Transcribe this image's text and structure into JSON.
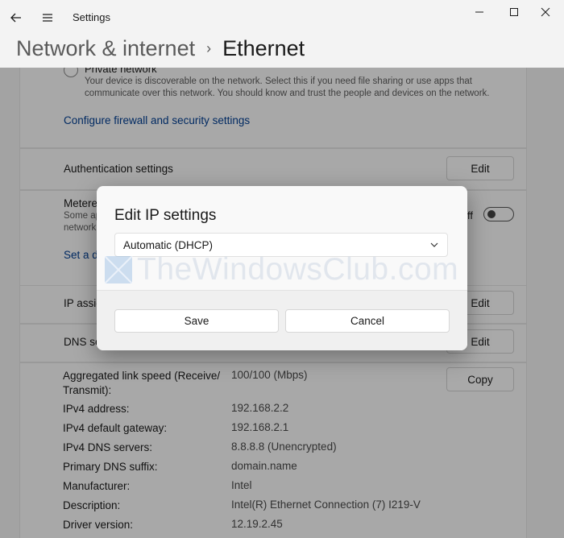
{
  "window": {
    "app_title": "Settings",
    "back_icon": "arrow-left-icon",
    "menu_icon": "hamburger-icon"
  },
  "breadcrumb": {
    "parent": "Network & internet",
    "separator": "›",
    "current": "Ethernet"
  },
  "network_profile": {
    "private_label": "Private network",
    "private_desc": "Your device is discoverable on the network. Select this if you need file sharing or use apps that communicate over this network. You should know and trust the people and devices on the network.",
    "firewall_link": "Configure firewall and security settings"
  },
  "authentication": {
    "label": "Authentication settings",
    "edit_label": "Edit"
  },
  "metered": {
    "label": "Metere",
    "desc_line1": "Some ap",
    "desc_line2": "network",
    "toggle_state": "ff",
    "data_limit_link": "Set a d"
  },
  "ip_assignment": {
    "label": "IP assig",
    "edit_label": "Edit"
  },
  "dns_assignment": {
    "label": "DNS se",
    "edit_label": "Edit"
  },
  "properties": {
    "copy_label": "Copy",
    "rows": [
      {
        "label": "Aggregated link speed (Receive/ Transmit):",
        "value": "100/100 (Mbps)"
      },
      {
        "label": "IPv4 address:",
        "value": "192.168.2.2"
      },
      {
        "label": "IPv4 default gateway:",
        "value": "192.168.2.1"
      },
      {
        "label": "IPv4 DNS servers:",
        "value": "8.8.8.8 (Unencrypted)"
      },
      {
        "label": "Primary DNS suffix:",
        "value": "domain.name"
      },
      {
        "label": "Manufacturer:",
        "value": "Intel"
      },
      {
        "label": "Description:",
        "value": "Intel(R) Ethernet Connection (7) I219-V"
      },
      {
        "label": "Driver version:",
        "value": "12.19.2.45"
      }
    ]
  },
  "dialog": {
    "title": "Edit IP settings",
    "dropdown_value": "Automatic (DHCP)",
    "save_label": "Save",
    "cancel_label": "Cancel"
  },
  "watermark": {
    "text": "TheWindowsClub.com"
  }
}
